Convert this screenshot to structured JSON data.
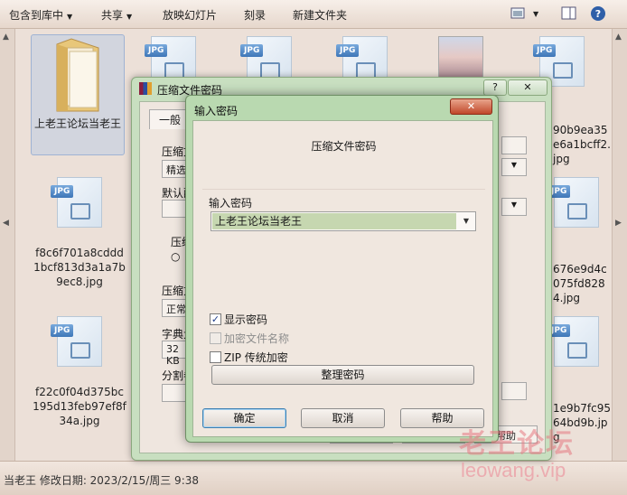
{
  "toolbar": {
    "items": [
      "包含到库中",
      "共享",
      "放映幻灯片",
      "刻录",
      "新建文件夹"
    ]
  },
  "files": {
    "folder_name": "上老王论坛当老王",
    "tile_label": "JPG",
    "names_left": [
      "f8c6f701a8cddd1bcf813d3a1a7b9ec8.jpg",
      "f22c0f04d375bc195d13feb97ef8f34a.jpg"
    ],
    "names_right_partial": [
      "90b9ea35e6a1bcff2.jpg",
      "676e9d4c075fd8284.jpg",
      "1e9b7fc9564bd9b.jpg"
    ]
  },
  "status": {
    "text": "当老王  修改日期: 2023/2/15/周三 9:38"
  },
  "rar_dialog": {
    "title": "压缩文件密码",
    "help_label": "?",
    "close_label": "✕",
    "tab_general": "一般",
    "lbl_archive": "压缩文",
    "lbl_select": "精选",
    "lbl_default": "默认配",
    "lbl_compress": "压缩",
    "lbl_method": "压缩方",
    "lbl_method_val": "正常",
    "lbl_dict": "字典大",
    "lbl_dict_val": "32 KB",
    "lbl_split": "分割卷",
    "ok_partial": "确定",
    "cancel_partial": "取消",
    "help_partial": "帮助"
  },
  "pw_dialog": {
    "title": "输入密码",
    "close_label": "✕",
    "heading": "压缩文件密码",
    "input_label": "输入密码",
    "input_value": "上老王论坛当老王",
    "checkbox_show": "显示密码",
    "checkbox_encrypt_names": "加密文件名称",
    "checkbox_zip": "ZIP 传统加密",
    "organize_button": "整理密码",
    "ok_button": "确定",
    "cancel_button": "取消",
    "help_button": "帮助",
    "show_checked": true
  },
  "watermark": {
    "cn": "老王论坛",
    "url": "leowang.vip"
  }
}
